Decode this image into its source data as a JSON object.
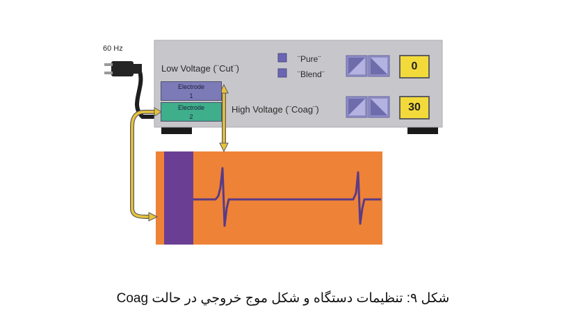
{
  "figure": {
    "power_label": "60 Hz",
    "low_voltage_label": "Low Voltage (¨Cut¨)",
    "high_voltage_label": "High Voltage (¨Coag¨)",
    "mode_pure": "¨Pure¨",
    "mode_blend": "¨Blend¨",
    "electrode1": {
      "line1": "Electrode",
      "line2": "1"
    },
    "electrode2": {
      "line1": "Electrode",
      "line2": "2"
    },
    "low_voltage_value": "0",
    "high_voltage_value": "30",
    "colors": {
      "device_body": "#c7c7cb",
      "electrode1": "#7c7bb8",
      "electrode2": "#3fae8a",
      "readout": "#f3da3b",
      "waveform_bg": "#ee8237",
      "waveform_bar": "#6a3f93",
      "waveform_line": "#5a3b86",
      "connector_wire": "#e8c33c",
      "mode_button": "#6a66b3"
    }
  },
  "caption": "شکل ۹: تنظیمات دستگاه و شکل موج خروجي در حالت Coag"
}
